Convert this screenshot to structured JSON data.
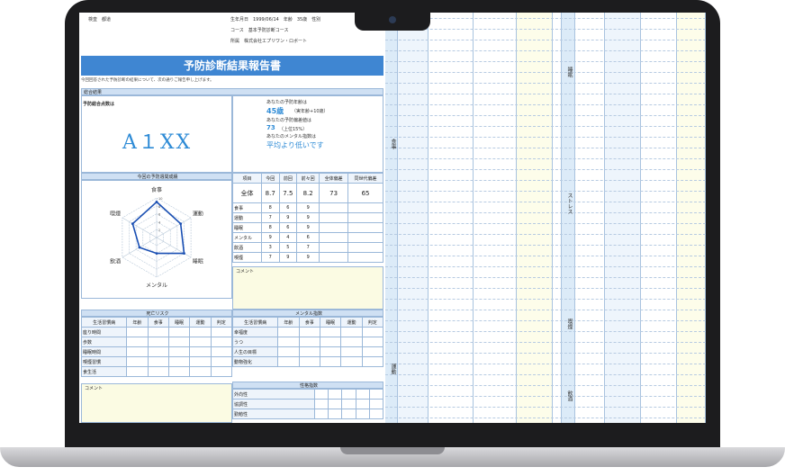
{
  "header": {
    "line1": "検査　都道",
    "birth": "生年月日　1999/06/14　年齢　35歳　性別",
    "course": "コース　基本予防診断コース",
    "company": "所属　株式会社エプリワン・ロボート"
  },
  "report": {
    "title": "予防診断結果報告書",
    "intro": "今回回答された予防診断の結果について、次の通りご報告申し上げます。",
    "overall_label": "総合結果",
    "score_label": "予防総合点数は",
    "grade": "A１XX",
    "age_label": "あなたの予防年齢は",
    "age_value": "45歳",
    "age_note": "（実年齢+10歳）",
    "dev_label": "あなたの予防偏差値は",
    "dev_value": "73",
    "dev_note": "（上位15%）",
    "mental_label": "あなたのメンタル指数は",
    "mental_value": "平均より低いです"
  },
  "radar": {
    "title": "今回の予防週間成績",
    "axes": [
      "食事",
      "運動",
      "睡眠",
      "メンタル",
      "飲酒",
      "喫煙"
    ],
    "values": [
      9,
      7,
      8,
      4,
      5,
      7
    ],
    "max": 10,
    "ticks": [
      "10",
      "8",
      "6",
      "4",
      "2"
    ]
  },
  "score_table": {
    "headers": [
      "項目",
      "今回",
      "前回",
      "前々回",
      "全体偏差",
      "同世代偏差"
    ],
    "total": [
      "全体",
      "8.7",
      "7.5",
      "8.2",
      "73",
      "65"
    ],
    "rows": [
      [
        "食事",
        "8",
        "6",
        "9"
      ],
      [
        "運動",
        "7",
        "9",
        "9"
      ],
      [
        "睡眠",
        "8",
        "6",
        "9"
      ],
      [
        "メンタル",
        "9",
        "4",
        "6"
      ],
      [
        "飲酒",
        "3",
        "5",
        "7"
      ],
      [
        "喫煙",
        "7",
        "9",
        "9"
      ]
    ],
    "comment_label": "コメント"
  },
  "risk": {
    "title": "死亡リスク",
    "headers": [
      "生活習慣病",
      "年齢",
      "食事",
      "睡眠",
      "運動",
      "判定"
    ],
    "rows": [
      "座り時間",
      "歩数",
      "睡眠時間",
      "喫煙習慣",
      "食生活"
    ],
    "comment_label": "コメント"
  },
  "mental": {
    "title": "メンタル指数",
    "headers": [
      "生活習慣病",
      "年齢",
      "食事",
      "睡眠",
      "運動",
      "判定"
    ],
    "rows": [
      "幸福度",
      "うつ",
      "人生の目標",
      "動物強化"
    ]
  },
  "personality": {
    "title": "性格指数",
    "rows": [
      "外向性",
      "協調性",
      "勤勉性"
    ]
  },
  "grid_labels": {
    "left": [
      "食事",
      "運動"
    ],
    "right": [
      "睡眠",
      "ストレス",
      "喫煙",
      "飲酒"
    ]
  }
}
